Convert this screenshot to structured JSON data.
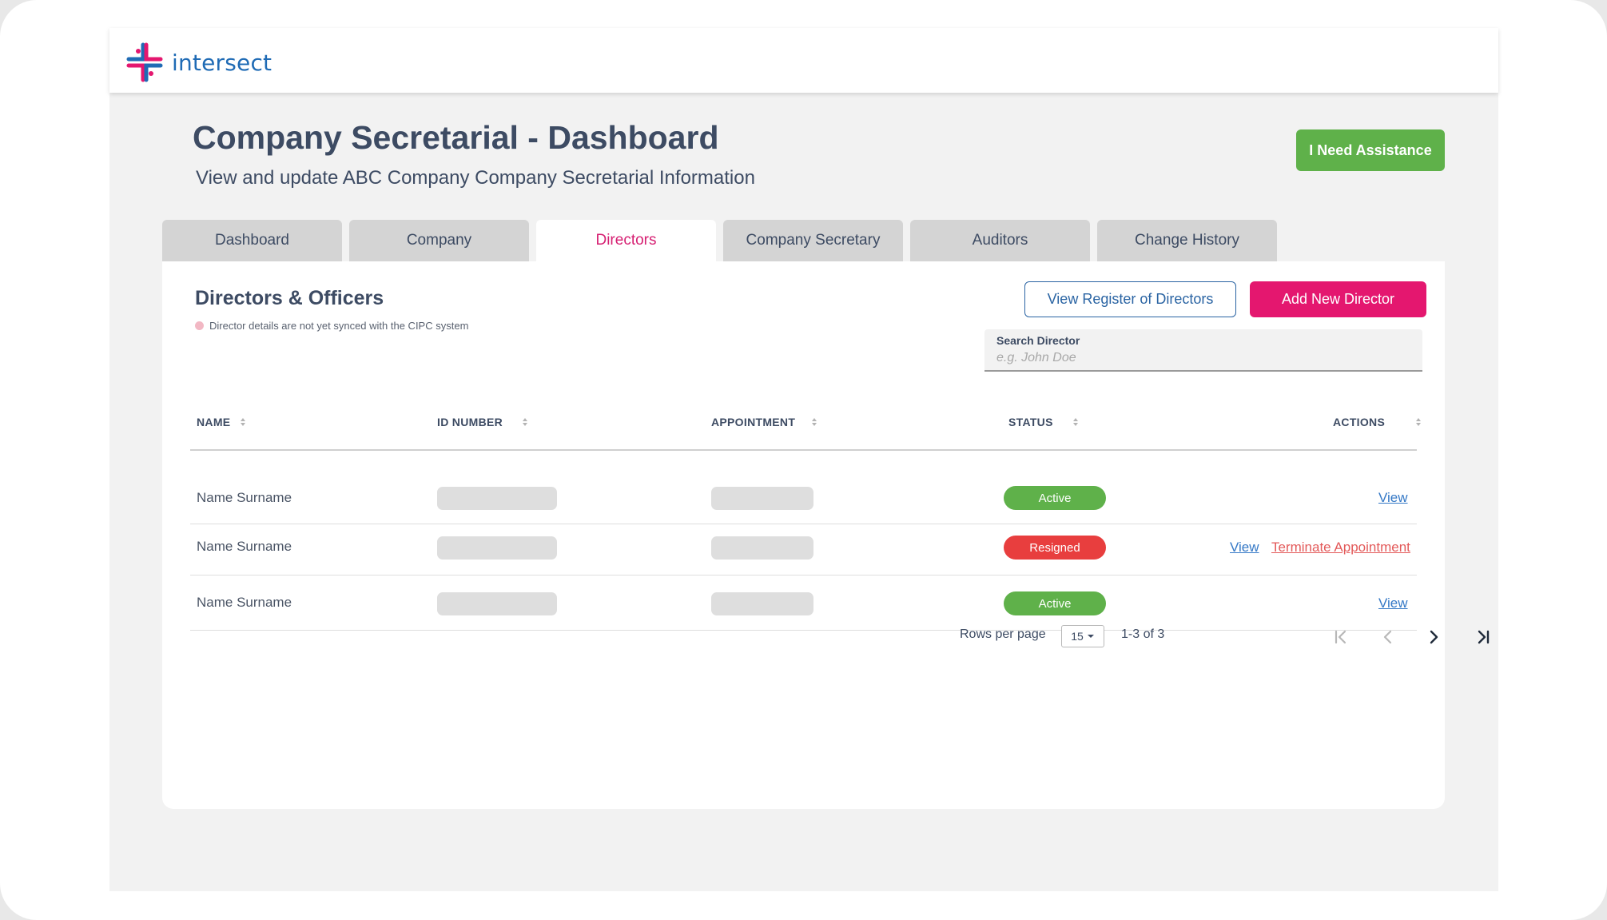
{
  "header": {
    "logo_text": "intersect",
    "colors": {
      "brand_blue": "#1f6bb5",
      "brand_pink": "#e4176f"
    }
  },
  "page": {
    "title": "Company Secretarial - Dashboard",
    "subtitle": "View and update ABC Company Company Secretarial Information",
    "assist_label": "I Need Assistance"
  },
  "tabs": [
    {
      "label": "Dashboard",
      "active": false
    },
    {
      "label": "Company",
      "active": false
    },
    {
      "label": "Directors",
      "active": true
    },
    {
      "label": "Company Secretary",
      "active": false
    },
    {
      "label": "Auditors",
      "active": false
    },
    {
      "label": "Change History",
      "active": false
    }
  ],
  "section": {
    "title": "Directors & Officers",
    "sync_note": "Director details are not yet synced with the CIPC system",
    "register_label": "View Register of Directors",
    "add_label": "Add New Director"
  },
  "search": {
    "label": "Search Director",
    "placeholder": "e.g. John Doe",
    "value": ""
  },
  "table": {
    "columns": [
      "NAME",
      "ID NUMBER",
      "APPOINTMENT",
      "STATUS",
      "ACTIONS"
    ],
    "rows": [
      {
        "name": "Name Surname",
        "status": "Active",
        "actions": [
          "View"
        ]
      },
      {
        "name": "Name Surname",
        "status": "Resigned",
        "actions": [
          "View",
          "Terminate Appointment"
        ]
      },
      {
        "name": "Name Surname",
        "status": "Active",
        "actions": [
          "View"
        ]
      }
    ]
  },
  "pagination": {
    "rows_per_page_label": "Rows per page",
    "rows_per_page": "15",
    "range": "1-3 of 3"
  },
  "icons": [
    "first-page-icon",
    "prev-page-icon",
    "next-page-icon",
    "last-page-icon",
    "sort-icon",
    "chevron-down-icon"
  ]
}
